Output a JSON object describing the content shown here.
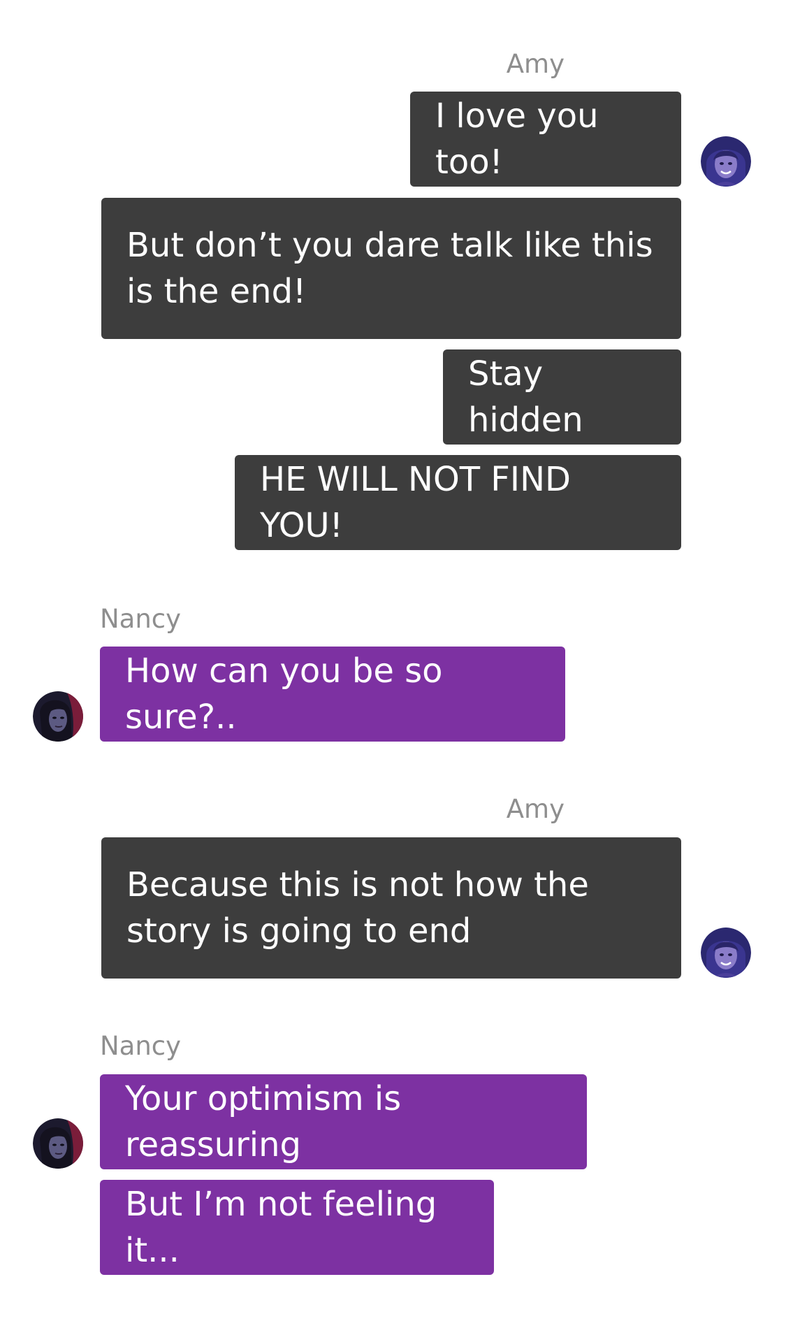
{
  "messages": [
    {
      "sender": "Amy",
      "texts": [
        "I love you too!",
        "But don’t you dare talk like this is the end!",
        "Stay hidden",
        "HE WILL NOT FIND YOU!"
      ]
    },
    {
      "sender": "Nancy",
      "texts": [
        "How can you be so sure?.."
      ]
    },
    {
      "sender": "Amy",
      "texts": [
        "Because this is not how the story is going to end"
      ]
    },
    {
      "sender": "Nancy",
      "texts": [
        "Your optimism is reassuring",
        "But I’m not feeling it..."
      ]
    }
  ],
  "colors": {
    "amy_bubble": "#3d3d3d",
    "nancy_bubble": "#7d31a2",
    "sender_name": "#8e8e8e",
    "background": "#ffffff"
  },
  "icons": {
    "amy_avatar": "amy-avatar-icon",
    "nancy_avatar": "nancy-avatar-icon"
  }
}
